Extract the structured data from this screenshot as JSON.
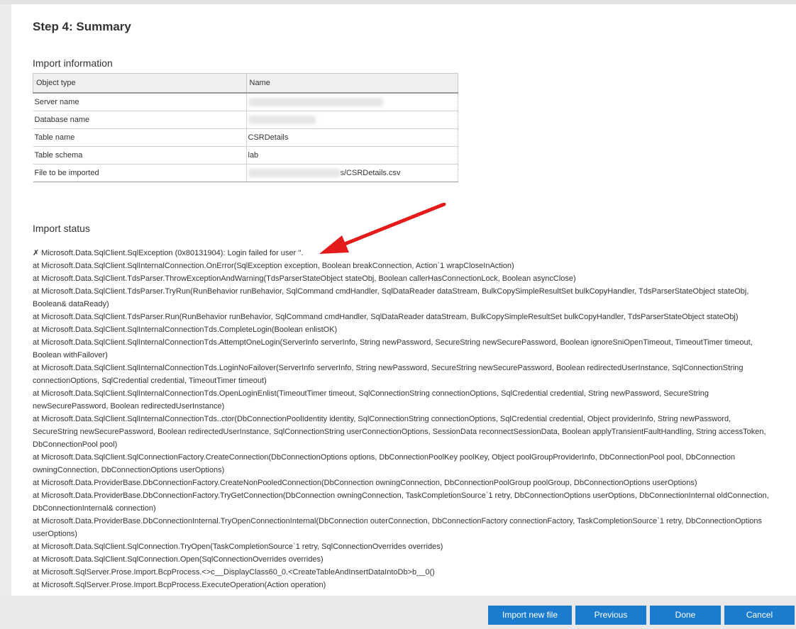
{
  "step_title": "Step 4: Summary",
  "import_info": {
    "title": "Import information",
    "columns": [
      "Object type",
      "Name"
    ],
    "rows": [
      {
        "type": "Server name",
        "name": ""
      },
      {
        "type": "Database name",
        "name": ""
      },
      {
        "type": "Table name",
        "name": "CSRDetails"
      },
      {
        "type": "Table schema",
        "name": "lab"
      },
      {
        "type": "File to be imported",
        "name": "s/CSRDetails.csv"
      }
    ]
  },
  "import_status": {
    "title": "Import status",
    "lines": [
      "✗ Microsoft.Data.SqlClient.SqlException (0x80131904): Login failed for user ''.",
      "at Microsoft.Data.SqlClient.SqlInternalConnection.OnError(SqlException exception, Boolean breakConnection, Action`1 wrapCloseInAction)",
      "at Microsoft.Data.SqlClient.TdsParser.ThrowExceptionAndWarning(TdsParserStateObject stateObj, Boolean callerHasConnectionLock, Boolean asyncClose)",
      "at Microsoft.Data.SqlClient.TdsParser.TryRun(RunBehavior runBehavior, SqlCommand cmdHandler, SqlDataReader dataStream, BulkCopySimpleResultSet bulkCopyHandler, TdsParserStateObject stateObj, Boolean& dataReady)",
      "at Microsoft.Data.SqlClient.TdsParser.Run(RunBehavior runBehavior, SqlCommand cmdHandler, SqlDataReader dataStream, BulkCopySimpleResultSet bulkCopyHandler, TdsParserStateObject stateObj)",
      "at Microsoft.Data.SqlClient.SqlInternalConnectionTds.CompleteLogin(Boolean enlistOK)",
      "at Microsoft.Data.SqlClient.SqlInternalConnectionTds.AttemptOneLogin(ServerInfo serverInfo, String newPassword, SecureString newSecurePassword, Boolean ignoreSniOpenTimeout, TimeoutTimer timeout, Boolean withFailover)",
      "at Microsoft.Data.SqlClient.SqlInternalConnectionTds.LoginNoFailover(ServerInfo serverInfo, String newPassword, SecureString newSecurePassword, Boolean redirectedUserInstance, SqlConnectionString connectionOptions, SqlCredential credential, TimeoutTimer timeout)",
      "at Microsoft.Data.SqlClient.SqlInternalConnectionTds.OpenLoginEnlist(TimeoutTimer timeout, SqlConnectionString connectionOptions, SqlCredential credential, String newPassword, SecureString newSecurePassword, Boolean redirectedUserInstance)",
      "at Microsoft.Data.SqlClient.SqlInternalConnectionTds..ctor(DbConnectionPoolIdentity identity, SqlConnectionString connectionOptions, SqlCredential credential, Object providerInfo, String newPassword, SecureString newSecurePassword, Boolean redirectedUserInstance, SqlConnectionString userConnectionOptions, SessionData reconnectSessionData, Boolean applyTransientFaultHandling, String accessToken, DbConnectionPool pool)",
      "at Microsoft.Data.SqlClient.SqlConnectionFactory.CreateConnection(DbConnectionOptions options, DbConnectionPoolKey poolKey, Object poolGroupProviderInfo, DbConnectionPool pool, DbConnection owningConnection, DbConnectionOptions userOptions)",
      "at Microsoft.Data.ProviderBase.DbConnectionFactory.CreateNonPooledConnection(DbConnection owningConnection, DbConnectionPoolGroup poolGroup, DbConnectionOptions userOptions)",
      "at Microsoft.Data.ProviderBase.DbConnectionFactory.TryGetConnection(DbConnection owningConnection, TaskCompletionSource`1 retry, DbConnectionOptions userOptions, DbConnectionInternal oldConnection, DbConnectionInternal& connection)",
      "at Microsoft.Data.ProviderBase.DbConnectionInternal.TryOpenConnectionInternal(DbConnection outerConnection, DbConnectionFactory connectionFactory, TaskCompletionSource`1 retry, DbConnectionOptions userOptions)",
      "at Microsoft.Data.SqlClient.SqlConnection.TryOpen(TaskCompletionSource`1 retry, SqlConnectionOverrides overrides)",
      "at Microsoft.Data.SqlClient.SqlConnection.Open(SqlConnectionOverrides overrides)",
      "at Microsoft.SqlServer.Prose.Import.BcpProcess.<>c__DisplayClass60_0.<CreateTableAndInsertDataIntoDb>b__0()",
      "at Microsoft.SqlServer.Prose.Import.BcpProcess.ExecuteOperation(Action operation)"
    ]
  },
  "buttons": {
    "import_new_file": "Import new file",
    "previous": "Previous",
    "done": "Done",
    "cancel": "Cancel"
  },
  "colors": {
    "button_blue": "#1b7ccf",
    "annotation_arrow": "#e31b1b"
  }
}
